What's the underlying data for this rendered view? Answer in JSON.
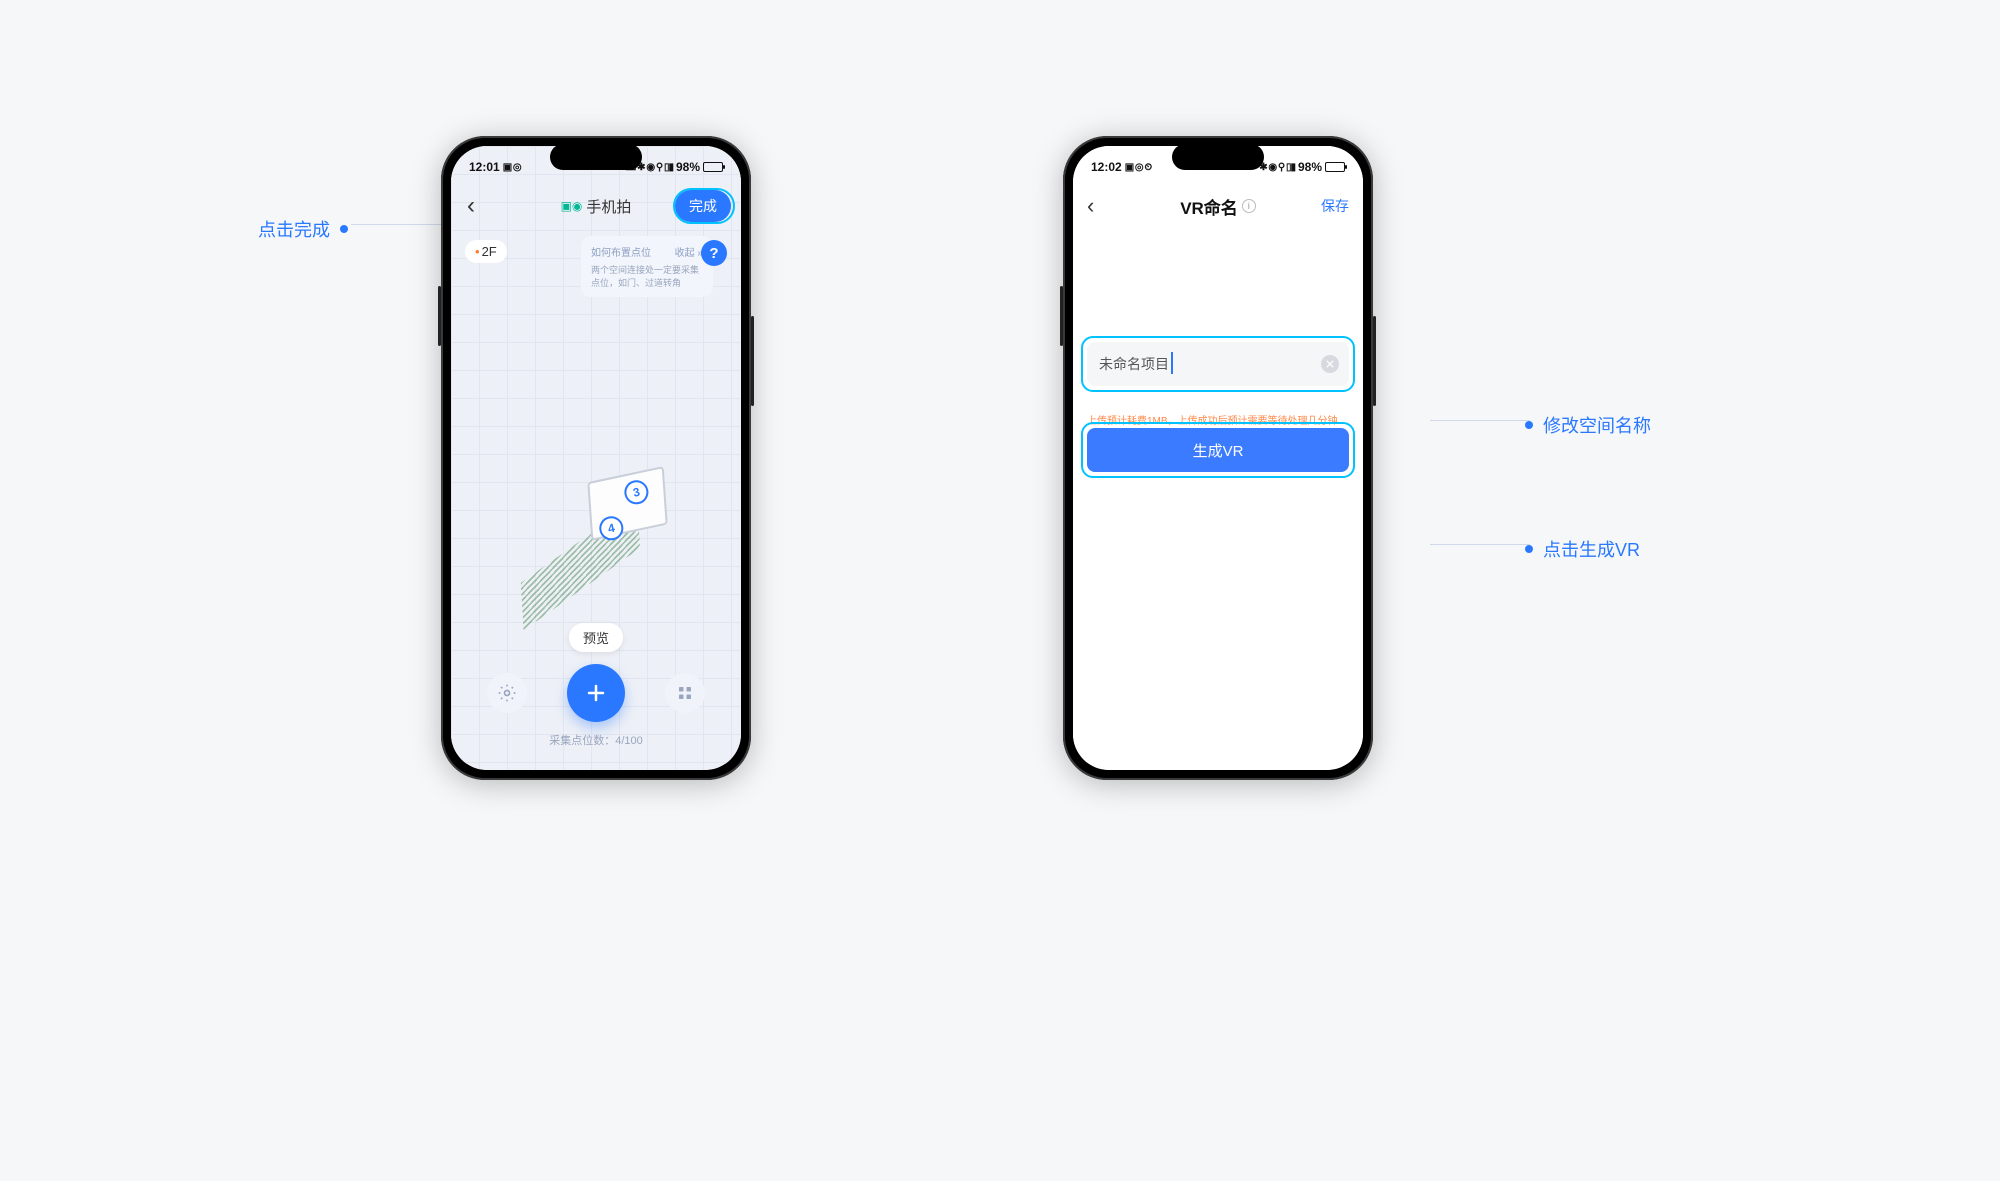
{
  "callouts": {
    "done": "点击完成",
    "rename": "修改空间名称",
    "generate": "点击生成VR"
  },
  "phone1": {
    "status": {
      "time": "12:01",
      "battery_pct": "98%"
    },
    "title": "手机拍",
    "done_label": "完成",
    "floor_label": "2F",
    "tip": {
      "title": "如何布置点位",
      "close": "收起 »",
      "body": "两个空间连接处一定要采集点位，如门、过道转角"
    },
    "help": "?",
    "pins": {
      "p3": "3",
      "p4": "4"
    },
    "preview_label": "预览",
    "count_text": "采集点位数：4/100"
  },
  "phone2": {
    "status": {
      "time": "12:02",
      "battery_pct": "98%"
    },
    "title": "VR命名",
    "save_label": "保存",
    "input_value": "未命名项目",
    "upload_note": "上传预计耗费1MB，上传成功后预计需要等待处理几分钟",
    "generate_label": "生成VR"
  }
}
